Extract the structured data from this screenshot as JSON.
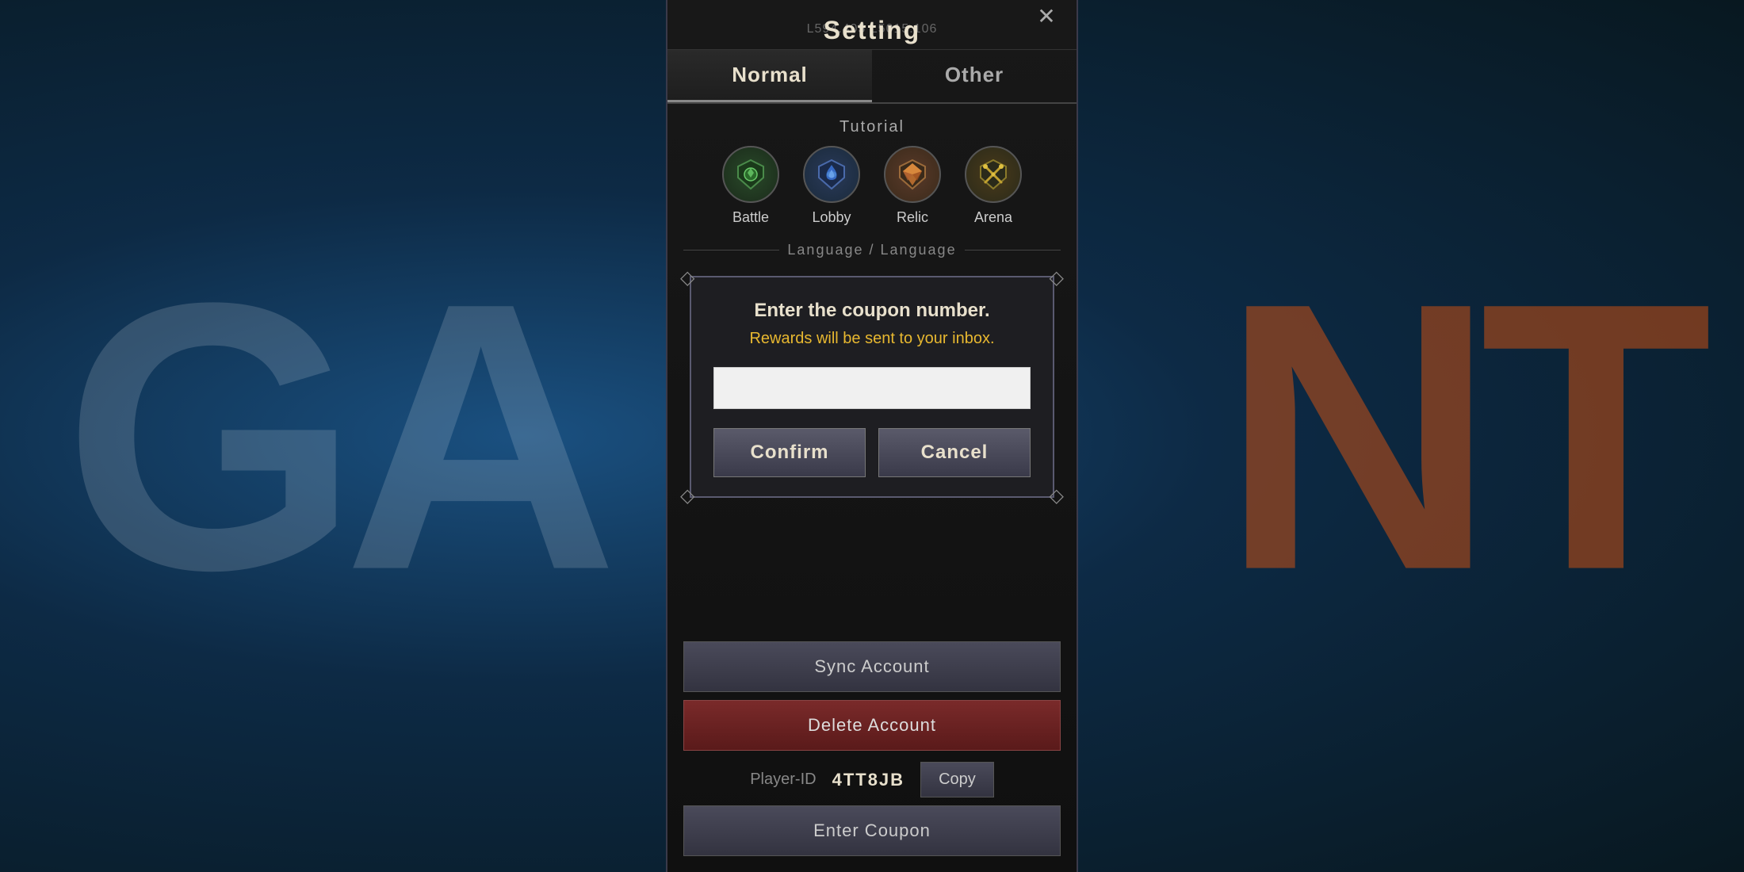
{
  "background": {
    "text_left": "GA",
    "text_right": "NT"
  },
  "header": {
    "coords": "L594.405   L5015.106",
    "title": "Setting",
    "close_label": "✕"
  },
  "tabs": [
    {
      "id": "normal",
      "label": "Normal",
      "active": true
    },
    {
      "id": "other",
      "label": "Other",
      "active": false
    }
  ],
  "tutorial": {
    "section_label": "Tutorial",
    "icons": [
      {
        "id": "battle",
        "label": "Battle",
        "emoji": "🛡"
      },
      {
        "id": "lobby",
        "label": "Lobby",
        "emoji": "🔵"
      },
      {
        "id": "relic",
        "label": "Relic",
        "emoji": "💠"
      },
      {
        "id": "arena",
        "label": "Arena",
        "emoji": "⚔"
      }
    ]
  },
  "language_divider": "Language / Language",
  "dialog": {
    "title": "Enter the coupon number.",
    "subtitle": "Rewards will be sent to your inbox.",
    "input_placeholder": "",
    "confirm_label": "Confirm",
    "cancel_label": "Cancel"
  },
  "bottom": {
    "sync_label": "Sync Account",
    "delete_label": "Delete Account",
    "player_id_label": "Player-ID",
    "player_id_value": "4TT8JB",
    "copy_label": "Copy",
    "enter_coupon_label": "Enter Coupon"
  }
}
